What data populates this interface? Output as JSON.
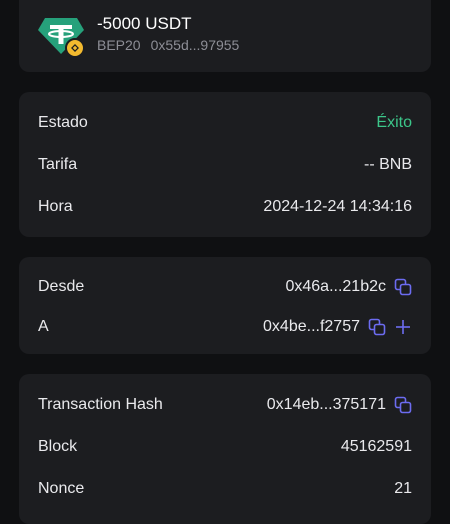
{
  "header": {
    "amount": "-5000 USDT",
    "network": "BEP20",
    "address": "0x55d...97955"
  },
  "status": {
    "state_label": "Estado",
    "state_value": "Éxito",
    "fee_label": "Tarifa",
    "fee_value": "-- BNB",
    "time_label": "Hora",
    "time_value": "2024-12-24 14:34:16"
  },
  "addresses": {
    "from_label": "Desde",
    "from_value": "0x46a...21b2c",
    "to_label": "A",
    "to_value": "0x4be...f2757"
  },
  "tx": {
    "hash_label": "Transaction Hash",
    "hash_value": "0x14eb...375171",
    "block_label": "Block",
    "block_value": "45162591",
    "nonce_label": "Nonce",
    "nonce_value": "21"
  },
  "colors": {
    "success": "#3cc68a",
    "accent_icon": "#6c6cf0",
    "tether": "#26a17b",
    "bnb": "#f3ba2f"
  },
  "icons": [
    "tether-icon",
    "bnb-icon",
    "copy-icon",
    "plus-icon"
  ]
}
